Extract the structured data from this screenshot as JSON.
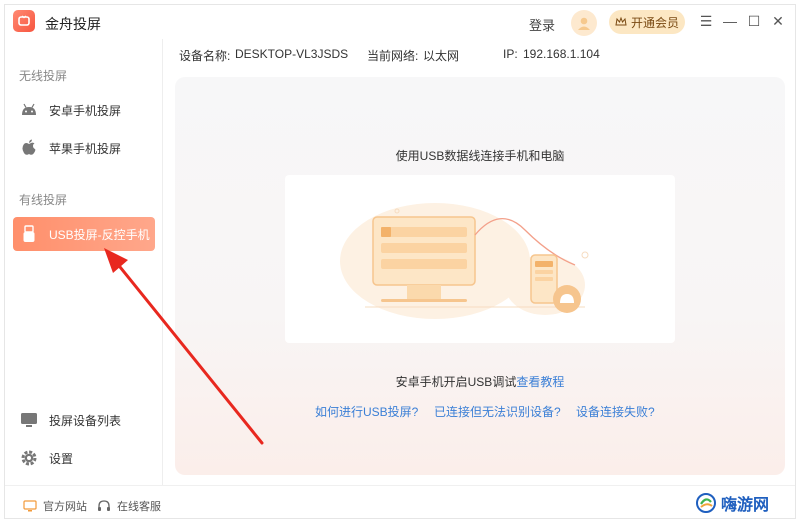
{
  "app": {
    "title": "金舟投屏",
    "login_label": "登录",
    "vip_label": "开通会员"
  },
  "window_controls": {
    "menu": "☰",
    "minimize": "—",
    "maximize": "☐",
    "close": "✕"
  },
  "sidebar": {
    "wireless_label": "无线投屏",
    "wired_label": "有线投屏",
    "items": [
      {
        "label": "安卓手机投屏",
        "icon": "android-icon"
      },
      {
        "label": "苹果手机投屏",
        "icon": "apple-icon"
      },
      {
        "label": "USB投屏-反控手机",
        "icon": "usb-icon"
      }
    ],
    "bottom_items": [
      {
        "label": "投屏设备列表",
        "icon": "device-list-icon"
      },
      {
        "label": "设置",
        "icon": "gear-icon"
      }
    ]
  },
  "info": {
    "device_label": "设备名称:",
    "device_value": "DESKTOP-VL3JSDS",
    "network_label": "当前网络:",
    "network_value": "以太网",
    "ip_label": "IP:",
    "ip_value": "192.168.1.104"
  },
  "main": {
    "usb_hint": "使用USB数据线连接手机和电脑",
    "debug_hint": "安卓手机开启USB调试",
    "tutorial_link": "查看教程",
    "help_links": [
      "如何进行USB投屏?",
      "已连接但无法识别设备?",
      "设备连接失败?"
    ]
  },
  "footer": {
    "official_site": "官方网站",
    "support": "在线客服"
  },
  "watermark": {
    "text": "嗨游网"
  },
  "colors": {
    "accent": "#ff8f6b",
    "link": "#3b7fd6",
    "vip_bg": "#fce7c3"
  }
}
